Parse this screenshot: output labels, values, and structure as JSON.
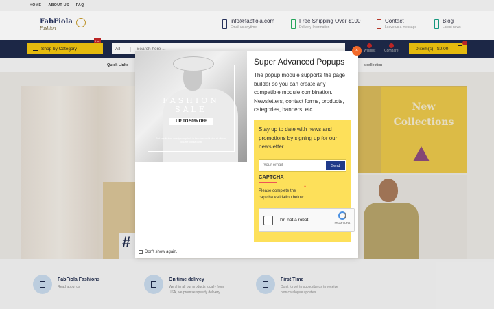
{
  "topbar": {
    "links": [
      "HOME",
      "ABOUT US",
      "FAQ"
    ]
  },
  "logo": {
    "name": "FabFiola",
    "tagline": "Fashion"
  },
  "header_info": [
    {
      "title": "info@fabfiola.com",
      "sub": "Email us anytime",
      "color": "#2a3560"
    },
    {
      "title": "Free Shipping Over $100",
      "sub": "Delivery Information",
      "color": "#27ae60"
    },
    {
      "title": "Contact",
      "sub": "Leave us a message",
      "color": "#c0392b"
    },
    {
      "title": "Blog",
      "sub": "Latest news",
      "color": "#16a085"
    }
  ],
  "nav": {
    "shop_by_category": "Shop by Category",
    "hot_badge": "Hot",
    "search_category": "All",
    "search_placeholder": "Search here ...",
    "wishlist": "Wishlist",
    "compare": "Compare",
    "cart": "0 item(s) - $0.00"
  },
  "quickbar": {
    "quick_links": "Quick Links",
    "collection": "s collection"
  },
  "hero": {
    "new_collections": "New Collections",
    "hashtag": "#"
  },
  "popup": {
    "close": "×",
    "title": "Super Advanced Popups",
    "description": "The popup module supports the page builder so you can create any compatible module combination. Newsletters, contact forms, products, categories, banners, etc.",
    "image": {
      "fashion_sale": "FASHION SALE",
      "discount": "UP TO 50% OFF",
      "fine_print": "Sed vestibulum ante ipsum primis in faucibus orci luctus et ultrices posuere cubilia curae"
    },
    "newsletter": {
      "lead": "Stay up to date with news and promotions by signing up for our newsletter",
      "email_placeholder": "Your email",
      "send": "Send",
      "captcha_title": "CAPTCHA",
      "captcha_note": "Please complete the captcha validation below",
      "captcha_required": "*",
      "recaptcha_label": "I'm not a robot",
      "recaptcha_brand": "reCAPTCHA"
    },
    "dont_show": "Don't show again."
  },
  "features": [
    {
      "title": "FabFiola Fashions",
      "sub": "Read about us"
    },
    {
      "title": "On time delivey",
      "sub": "We ship all our products locally from USA, we promise speedy delivery"
    },
    {
      "title": "First Time",
      "sub": "Don't forget to subscribe us to receive new catalogue updates"
    }
  ]
}
